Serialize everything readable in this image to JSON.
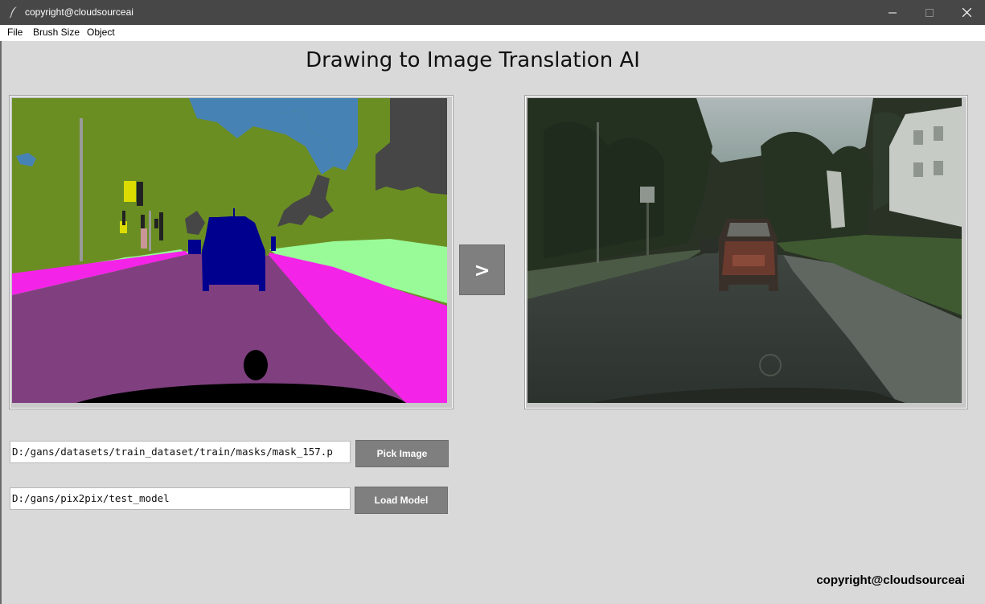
{
  "window": {
    "title": "copyright@cloudsourceai",
    "controls": [
      "minimize",
      "maximize",
      "close"
    ]
  },
  "menubar": {
    "items": [
      "File",
      "Brush Size",
      "Object"
    ]
  },
  "main": {
    "heading": "Drawing to Image Translation AI",
    "translate_button": ">",
    "input_panel": {
      "image": "segmentation-mask-drawing",
      "description": "street scene mask with car, road, trees, sky, poles"
    },
    "output_panel": {
      "image": "generated-street-photo"
    }
  },
  "controls": {
    "image_path": "D:/gans/datasets/train_dataset/train/masks/mask_157.p",
    "pick_image_label": "Pick Image",
    "model_path": "D:/gans/pix2pix/test_model",
    "load_model_label": "Load Model"
  },
  "footer": {
    "copyright": "copyright@cloudsourceai"
  },
  "colors": {
    "window_bg": "#d9d9d9",
    "titlebar": "#474747",
    "button_bg": "#7f7f7f",
    "mask_trees": "#6b8e23",
    "mask_sky": "#4682b4",
    "mask_road": "#804080",
    "mask_sidewalk": "#f423e8",
    "mask_terrain": "#98fb98",
    "mask_car": "#00008e",
    "mask_building": "#464646"
  }
}
